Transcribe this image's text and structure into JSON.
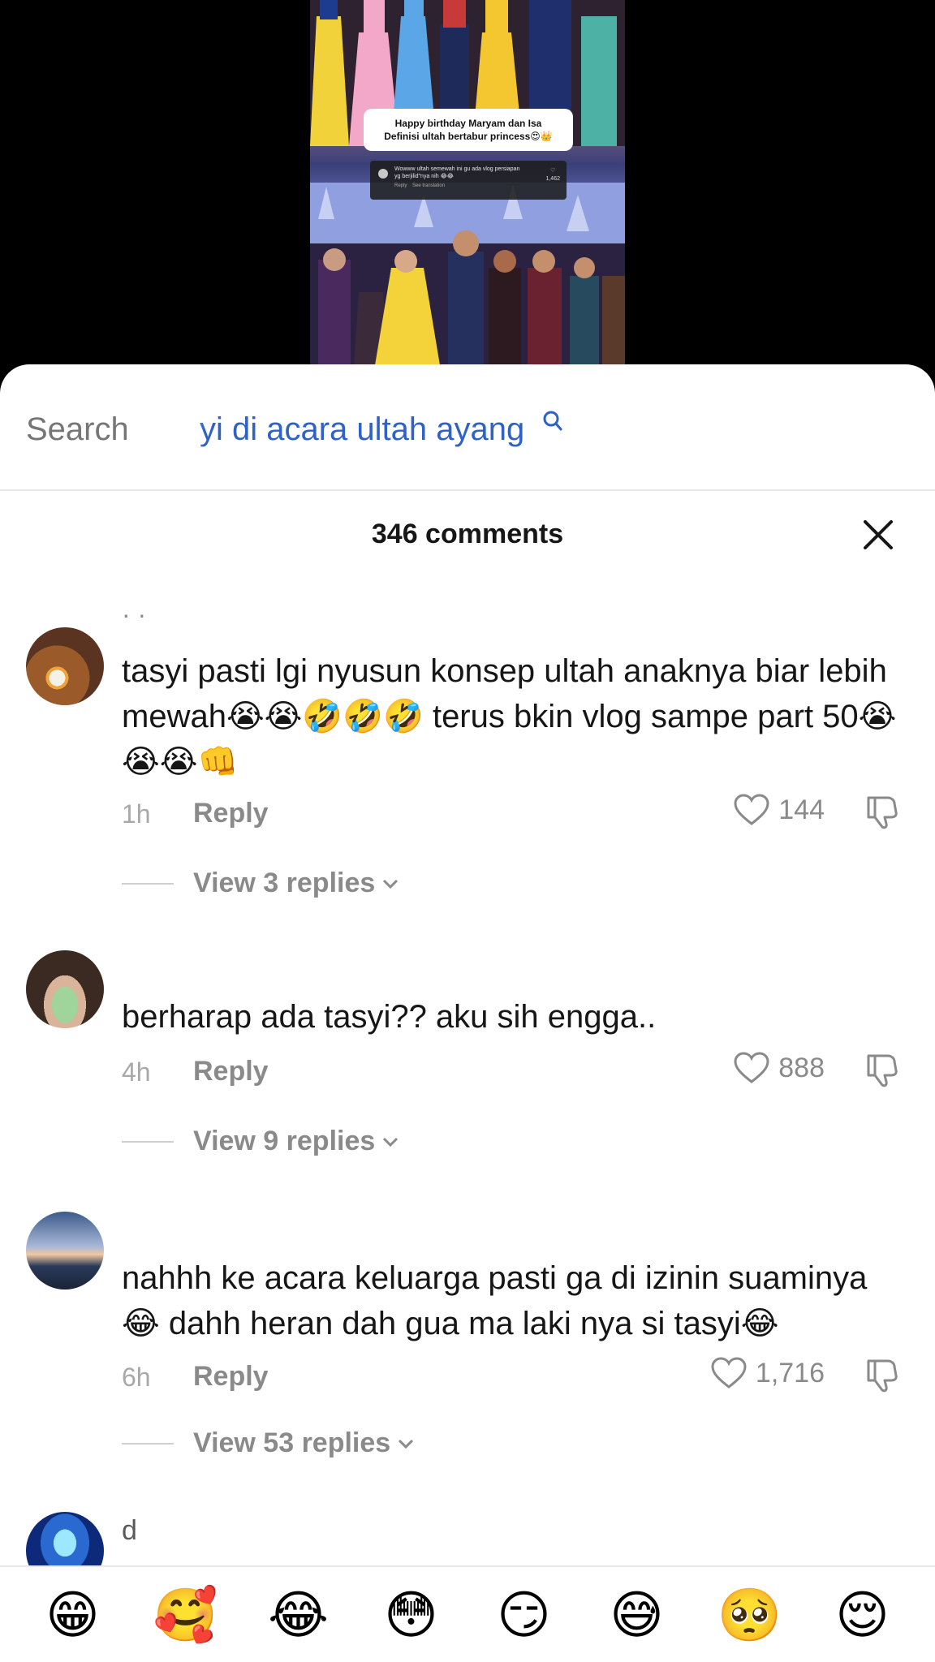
{
  "video": {
    "caption_line1": "Happy birthday Maryam dan Isa",
    "caption_line2": "Definisi ultah bertabur princess😍👑",
    "mini_comment": {
      "text": "Wowww ultah semewah ini gu ada vlog persiapan yg berjilid\"nya nih 😂😂",
      "likes": "1,462",
      "reply": "Reply",
      "see_translation": "See translation"
    }
  },
  "search": {
    "label": "Search",
    "query": "yi di acara ultah ayang",
    "icon": "search-icon"
  },
  "comments_header": {
    "count": "346 comments",
    "close_icon": "close-icon"
  },
  "comments": [
    {
      "username": "· ·",
      "text": "tasyi pasti lgi nyusun konsep ultah anaknya biar lebih mewah😭😭🤣🤣🤣 terus bkin vlog sampe part 50😭😭😭👊",
      "time": "1h",
      "reply": "Reply",
      "likes": "144",
      "view_replies": "View 3 replies"
    },
    {
      "username": "",
      "text": "berharap ada tasyi?? aku sih engga..",
      "time": "4h",
      "reply": "Reply",
      "likes": "888",
      "view_replies": "View 9 replies"
    },
    {
      "username": "",
      "text": "nahhh ke acara keluarga pasti ga di izinin suaminya😂 dahh heran dah gua ma laki nya si tasyi😂",
      "time": "6h",
      "reply": "Reply",
      "likes": "1,716",
      "view_replies": "View 53 replies"
    },
    {
      "username": "d"
    }
  ],
  "emoji_bar": [
    "😁",
    "🥰",
    "😂",
    "😳",
    "😏",
    "😅",
    "🥺",
    "😌"
  ],
  "colors": {
    "search_query": "#2f62c9",
    "muted_text": "#8a8a8a",
    "primary_text": "#161616"
  }
}
